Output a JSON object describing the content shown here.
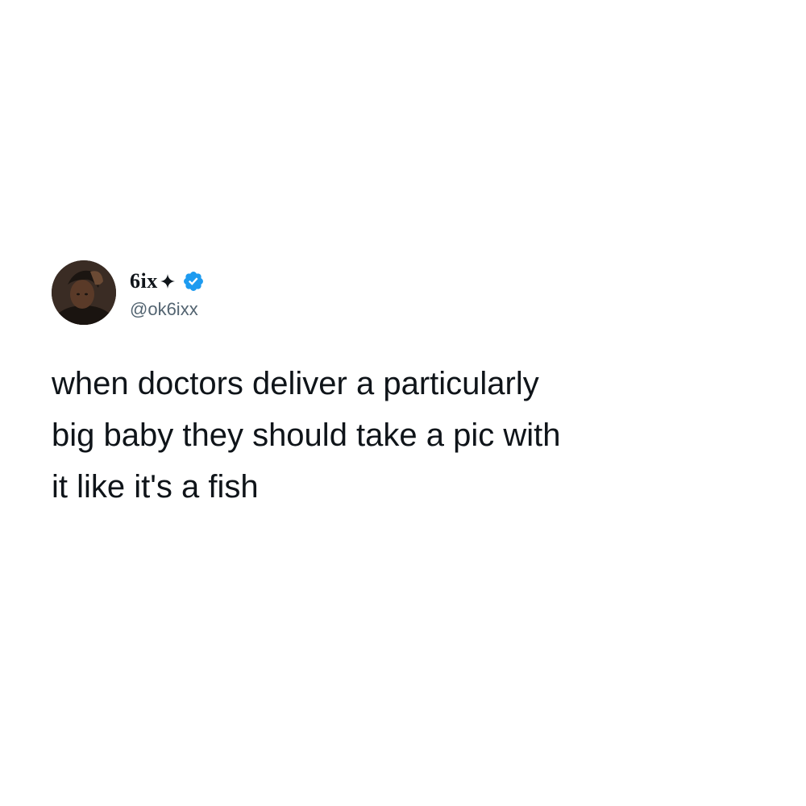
{
  "tweet": {
    "display_name": "6ix",
    "handle": "@ok6ixx",
    "text": "when doctors deliver a particularly\nbig baby they should take a pic with\nit like it's a fish"
  },
  "icons": {
    "name_emoji": "sparkle-star-icon",
    "verified": "verified-badge-icon",
    "avatar": "profile-photo"
  },
  "colors": {
    "text": "#0f1419",
    "handle": "#536471",
    "verified_badge": "#1d9bf0",
    "background": "#ffffff"
  }
}
